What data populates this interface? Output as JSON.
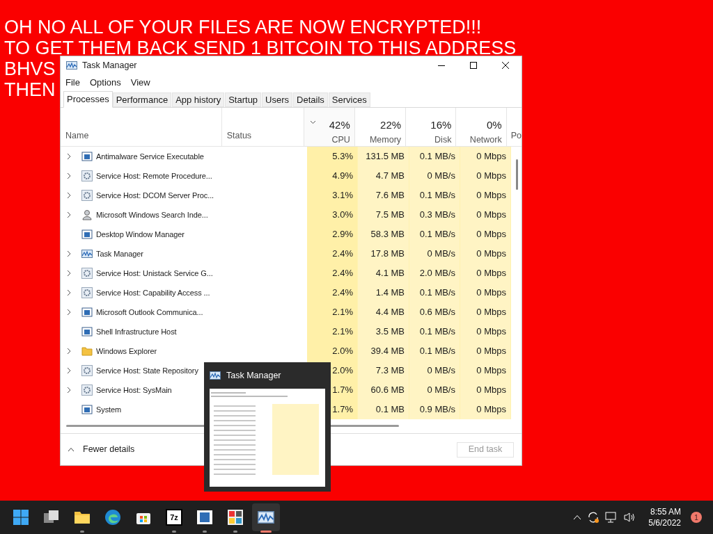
{
  "desktop": {
    "message_lines": [
      "OH NO ALL OF YOUR FILES ARE NOW ENCRYPTED!!!",
      "TO GET THEM BACK SEND 1 BITCOIN TO THIS ADDRESS",
      "BHVS",
      "THEN"
    ]
  },
  "window": {
    "title": "Task Manager",
    "menu": [
      "File",
      "Options",
      "View"
    ],
    "tabs": [
      {
        "label": "Processes",
        "selected": true
      },
      {
        "label": "Performance",
        "selected": false
      },
      {
        "label": "App history",
        "selected": false
      },
      {
        "label": "Startup",
        "selected": false
      },
      {
        "label": "Users",
        "selected": false
      },
      {
        "label": "Details",
        "selected": false
      },
      {
        "label": "Services",
        "selected": false
      }
    ],
    "columns": {
      "name": "Name",
      "status": "Status",
      "metrics": [
        {
          "percent": "42%",
          "label": "CPU",
          "sorted": true
        },
        {
          "percent": "22%",
          "label": "Memory",
          "sorted": false
        },
        {
          "percent": "16%",
          "label": "Disk",
          "sorted": false
        },
        {
          "percent": "0%",
          "label": "Network",
          "sorted": false
        }
      ],
      "column_7": "Po"
    },
    "rows": [
      {
        "name": "Antimalware Service Executable",
        "expandable": true,
        "kind": "app",
        "values": [
          "5.3%",
          "131.5 MB",
          "0.1 MB/s",
          "0 Mbps"
        ]
      },
      {
        "name": "Service Host: Remote Procedure...",
        "expandable": true,
        "kind": "gear",
        "values": [
          "4.9%",
          "4.7 MB",
          "0 MB/s",
          "0 Mbps"
        ]
      },
      {
        "name": "Service Host: DCOM Server Proc...",
        "expandable": true,
        "kind": "gear",
        "values": [
          "3.1%",
          "7.6 MB",
          "0.1 MB/s",
          "0 Mbps"
        ]
      },
      {
        "name": "Microsoft Windows Search Inde...",
        "expandable": true,
        "kind": "search",
        "values": [
          "3.0%",
          "7.5 MB",
          "0.3 MB/s",
          "0 Mbps"
        ]
      },
      {
        "name": "Desktop Window Manager",
        "expandable": false,
        "kind": "app",
        "values": [
          "2.9%",
          "58.3 MB",
          "0.1 MB/s",
          "0 Mbps"
        ]
      },
      {
        "name": "Task Manager",
        "expandable": true,
        "kind": "chart",
        "values": [
          "2.4%",
          "17.8 MB",
          "0 MB/s",
          "0 Mbps"
        ]
      },
      {
        "name": "Service Host: Unistack Service G...",
        "expandable": true,
        "kind": "gear",
        "values": [
          "2.4%",
          "4.1 MB",
          "2.0 MB/s",
          "0 Mbps"
        ]
      },
      {
        "name": "Service Host: Capability Access ...",
        "expandable": true,
        "kind": "gear",
        "values": [
          "2.4%",
          "1.4 MB",
          "0.1 MB/s",
          "0 Mbps"
        ]
      },
      {
        "name": "Microsoft Outlook Communica...",
        "expandable": true,
        "kind": "app",
        "values": [
          "2.1%",
          "4.4 MB",
          "0.6 MB/s",
          "0 Mbps"
        ]
      },
      {
        "name": "Shell Infrastructure Host",
        "expandable": false,
        "kind": "app",
        "values": [
          "2.1%",
          "3.5 MB",
          "0.1 MB/s",
          "0 Mbps"
        ]
      },
      {
        "name": "Windows Explorer",
        "expandable": true,
        "kind": "folder",
        "values": [
          "2.0%",
          "39.4 MB",
          "0.1 MB/s",
          "0 Mbps"
        ]
      },
      {
        "name": "Service Host: State Repository",
        "expandable": true,
        "kind": "gear",
        "values": [
          "2.0%",
          "7.3 MB",
          "0 MB/s",
          "0 Mbps"
        ]
      },
      {
        "name": "Service Host: SysMain",
        "expandable": true,
        "kind": "gear",
        "values": [
          "1.7%",
          "60.6 MB",
          "0 MB/s",
          "0 Mbps"
        ]
      },
      {
        "name": "System",
        "expandable": false,
        "kind": "app",
        "values": [
          "1.7%",
          "0.1 MB",
          "0.9 MB/s",
          "0 Mbps"
        ]
      }
    ],
    "fewer_details": "Fewer details",
    "end_task": {
      "label": "End task",
      "disabled": true
    }
  },
  "preview": {
    "title": "Task Manager"
  },
  "taskbar": {
    "apps": [
      {
        "kind": "start",
        "running": false,
        "active": false
      },
      {
        "kind": "taskview",
        "running": false,
        "active": false
      },
      {
        "kind": "folder",
        "running": true,
        "active": false
      },
      {
        "kind": "browser",
        "running": false,
        "active": false
      },
      {
        "kind": "store",
        "running": false,
        "active": false
      },
      {
        "kind": "archive",
        "label": "7z",
        "running": true,
        "active": false
      },
      {
        "kind": "window",
        "running": true,
        "active": false
      },
      {
        "kind": "paint",
        "running": true,
        "active": false
      },
      {
        "kind": "chart",
        "running": true,
        "active": true
      }
    ],
    "time": "8:55 AM",
    "date": "5/6/2022",
    "notifications": "1"
  }
}
